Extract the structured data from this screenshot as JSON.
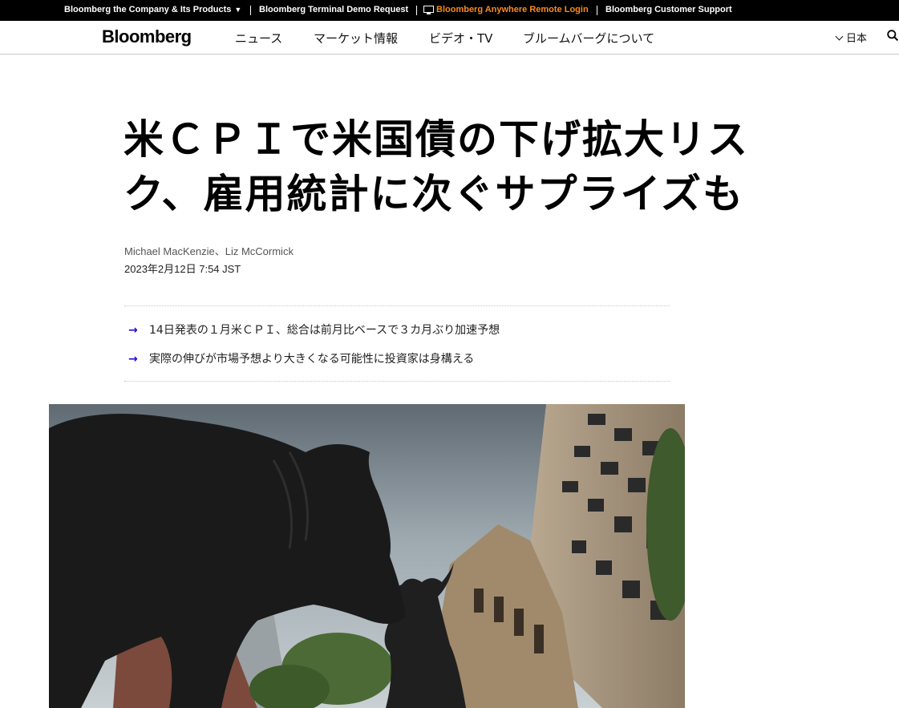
{
  "topbar": {
    "company": "Bloomberg the Company & Its Products",
    "terminal_demo": "Bloomberg Terminal Demo Request",
    "anywhere_login": "Bloomberg Anywhere Remote Login",
    "support": "Bloomberg Customer Support",
    "accent_color": "#fb8b1e"
  },
  "nav": {
    "logo": "Bloomberg",
    "items": [
      "ニュース",
      "マーケット情報",
      "ビデオ・TV",
      "ブルームバーグについて"
    ],
    "language": "日本",
    "icons": [
      "chevron-down-icon",
      "search-icon"
    ]
  },
  "article": {
    "headline_line1": "米ＣＰＩで米国債の下げ拡大リス",
    "headline_line2": "ク、雇用統計に次ぐサプライズも",
    "authors": "Michael MacKenzie、Liz McCormick",
    "published": "2023年2月12日 7:54 JST",
    "summary": [
      "14日発表の１月米ＣＰＩ、総合は前月比ベースで３カ月ぶり加速予想",
      "実際の伸びが市場予想より大きくなる可能性に投資家は身構える"
    ],
    "bullet_color": "#2800d7",
    "image_subject": "bear-and-bull-statues-photo"
  }
}
